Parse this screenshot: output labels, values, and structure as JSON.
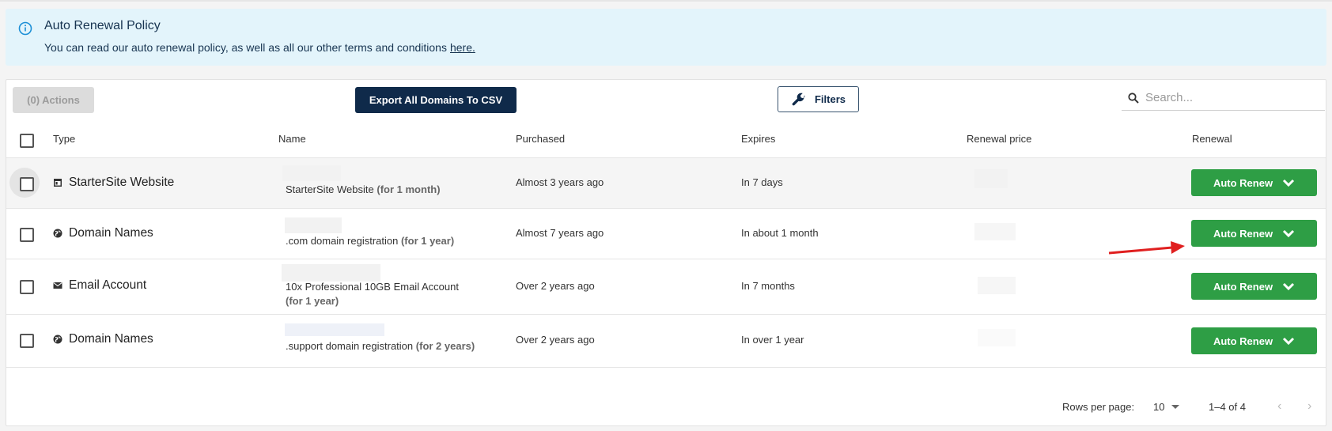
{
  "banner": {
    "title": "Auto Renewal Policy",
    "text": "You can read our auto renewal policy, as well as all our other terms and conditions",
    "link": "here."
  },
  "toolbar": {
    "actions_label": "(0) Actions",
    "export_label": "Export All Domains To CSV",
    "filters_label": "Filters",
    "search_placeholder": "Search..."
  },
  "columns": [
    "Type",
    "Name",
    "Purchased",
    "Expires",
    "Renewal price",
    "Renewal"
  ],
  "rows": [
    {
      "type": "StarterSite Website",
      "type_icon": "website-icon",
      "name": "StarterSite Website",
      "term": "(for 1 month)",
      "purchased": "Almost 3 years ago",
      "expires": "In 7 days",
      "renewal": "Auto Renew"
    },
    {
      "type": "Domain Names",
      "type_icon": "globe-icon",
      "name": ".com domain registration",
      "term": "(for 1 year)",
      "purchased": "Almost 7 years ago",
      "expires": "In about 1 month",
      "renewal": "Auto Renew"
    },
    {
      "type": "Email Account",
      "type_icon": "envelope-icon",
      "name": "10x Professional 10GB Email Account",
      "term": "(for 1 year)",
      "purchased": "Over 2 years ago",
      "expires": "In 7 months",
      "renewal": "Auto Renew"
    },
    {
      "type": "Domain Names",
      "type_icon": "globe-icon",
      "name": ".support domain registration",
      "term": "(for 2 years)",
      "purchased": "Over 2 years ago",
      "expires": "In over 1 year",
      "renewal": "Auto Renew"
    }
  ],
  "pagination": {
    "rows_per_page_label": "Rows per page:",
    "rows_per_page": "10",
    "range": "1–4 of 4"
  },
  "colors": {
    "banner_bg": "#e3f4fb",
    "export_bg": "#0f2a4a",
    "renew_green": "#2e9e45",
    "arrow_red": "#e02020"
  }
}
